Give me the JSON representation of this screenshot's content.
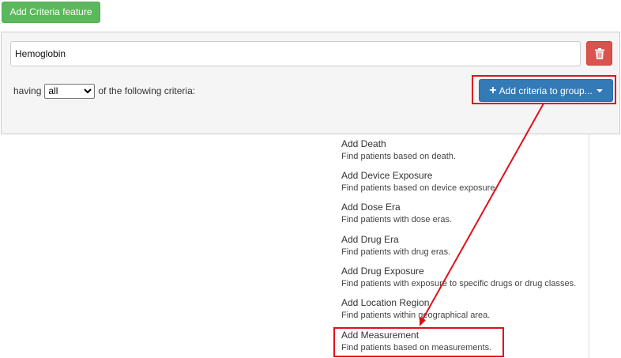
{
  "toolbar": {
    "add_criteria_feature_label": "Add Criteria feature"
  },
  "group": {
    "name_value": "Hemoglobin",
    "having_prefix": "having",
    "having_select_value": "all",
    "having_suffix": "of the following criteria:",
    "add_criteria_label": "Add criteria to group...",
    "delete_icon": "trash-icon"
  },
  "menu": {
    "items": [
      {
        "title": "Add Death",
        "desc": "Find patients based on death."
      },
      {
        "title": "Add Device Exposure",
        "desc": "Find patients based on device exposure."
      },
      {
        "title": "Add Dose Era",
        "desc": "Find patients with dose eras."
      },
      {
        "title": "Add Drug Era",
        "desc": "Find patients with drug eras."
      },
      {
        "title": "Add Drug Exposure",
        "desc": "Find patients with exposure to specific drugs or drug classes."
      },
      {
        "title": "Add Location Region",
        "desc": "Find patients within geographical area."
      },
      {
        "title": "Add Measurement",
        "desc": "Find patients based on measurements."
      }
    ]
  },
  "colors": {
    "success": "#5cb85c",
    "primary": "#337ab7",
    "danger": "#d9534f",
    "annotation": "#e0101a"
  }
}
